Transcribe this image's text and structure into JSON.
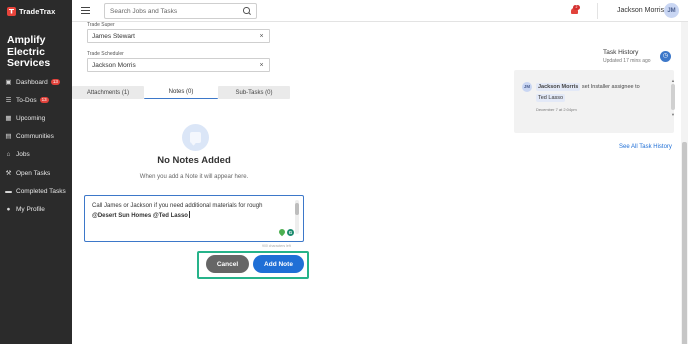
{
  "app": {
    "brand": "TradeTrax",
    "company_name": "Amplify Electric Services"
  },
  "header": {
    "search_placeholder": "Search Jobs and Tasks",
    "notification_count": "2",
    "user_name": "Jackson Morris",
    "user_initials": "JM"
  },
  "sidebar": {
    "items": [
      {
        "label": "Dashboard",
        "icon": "dashboard-icon",
        "badge": "13"
      },
      {
        "label": "To-Dos",
        "icon": "todo-icon",
        "badge": "13"
      },
      {
        "label": "Upcoming",
        "icon": "calendar-icon",
        "badge": ""
      },
      {
        "label": "Communities",
        "icon": "building-icon",
        "badge": ""
      },
      {
        "label": "Jobs",
        "icon": "home-icon",
        "badge": ""
      },
      {
        "label": "Open Tasks",
        "icon": "wrench-icon",
        "badge": ""
      },
      {
        "label": "Completed Tasks",
        "icon": "truck-icon",
        "badge": ""
      },
      {
        "label": "My Profile",
        "icon": "user-icon",
        "badge": ""
      }
    ]
  },
  "fields": {
    "trade_super": {
      "label": "Trade Super",
      "value": "James Stewart"
    },
    "trade_scheduler": {
      "label": "Trade Scheduler",
      "value": "Jackson Morris"
    }
  },
  "tabs": [
    {
      "label": "Attachments (1)",
      "active": false
    },
    {
      "label": "Notes (0)",
      "active": true
    },
    {
      "label": "Sub-Tasks (0)",
      "active": false
    }
  ],
  "notes": {
    "empty_title": "No Notes Added",
    "empty_subtitle": "When you add a Note it will appear here.",
    "draft_text": "Call James or Jackson if you need additional materials for rough",
    "draft_mention_1": "@Desert Sun Homes",
    "draft_mention_2": "@Ted Lasso",
    "char_counter": "900 characters left",
    "cancel_label": "Cancel",
    "add_label": "Add Note"
  },
  "task_history": {
    "title": "Task History",
    "updated": "Updated 17 mins ago",
    "entry": {
      "initials": "JM",
      "user": "Jackson Morris",
      "action": "set Installer assignee to",
      "assignee": "Ted Lasso",
      "date": "December 7 at 2:04pm"
    },
    "see_all": "See All Task History"
  },
  "colors": {
    "accent": "#1f6fd6",
    "sidebar": "#2b2b2b",
    "highlight": "#26b38a",
    "badge": "#e2423b"
  }
}
